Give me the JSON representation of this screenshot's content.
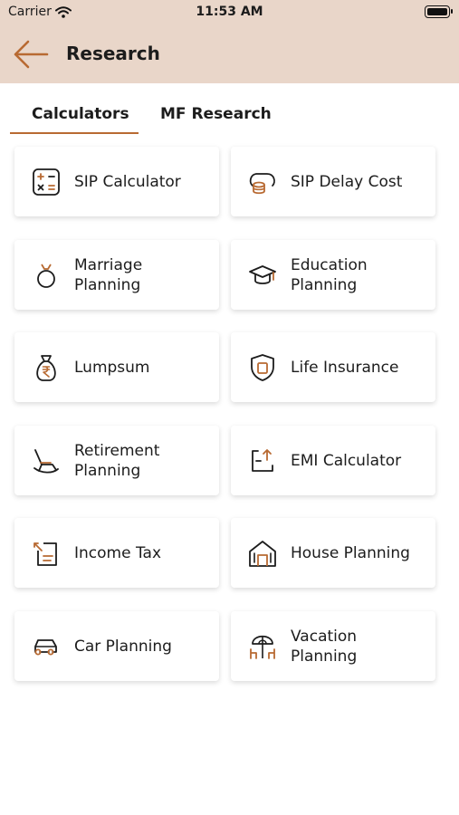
{
  "status": {
    "carrier": "Carrier",
    "time": "11:53 AM"
  },
  "header": {
    "title": "Research"
  },
  "tabs": [
    {
      "label": "Calculators"
    },
    {
      "label": "MF Research"
    }
  ],
  "colors": {
    "header_bg": "#e9d6c9",
    "accent": "#b86a32"
  },
  "calculators": [
    {
      "label": "SIP Calculator",
      "icon": "calculator-icon"
    },
    {
      "label": "SIP Delay Cost",
      "icon": "coin-stack-icon"
    },
    {
      "label": "Marriage\nPlanning",
      "icon": "ring-icon"
    },
    {
      "label": "Education\nPlanning",
      "icon": "graduation-cap-icon"
    },
    {
      "label": "Lumpsum",
      "icon": "money-bag-icon"
    },
    {
      "label": "Life Insurance",
      "icon": "shield-icon"
    },
    {
      "label": "Retirement\nPlanning",
      "icon": "rocking-chair-icon"
    },
    {
      "label": "EMI Calculator",
      "icon": "emi-icon"
    },
    {
      "label": "Income Tax",
      "icon": "tax-document-icon"
    },
    {
      "label": "House Planning",
      "icon": "house-icon"
    },
    {
      "label": "Car Planning",
      "icon": "car-icon"
    },
    {
      "label": "Vacation\nPlanning",
      "icon": "beach-umbrella-icon"
    }
  ]
}
